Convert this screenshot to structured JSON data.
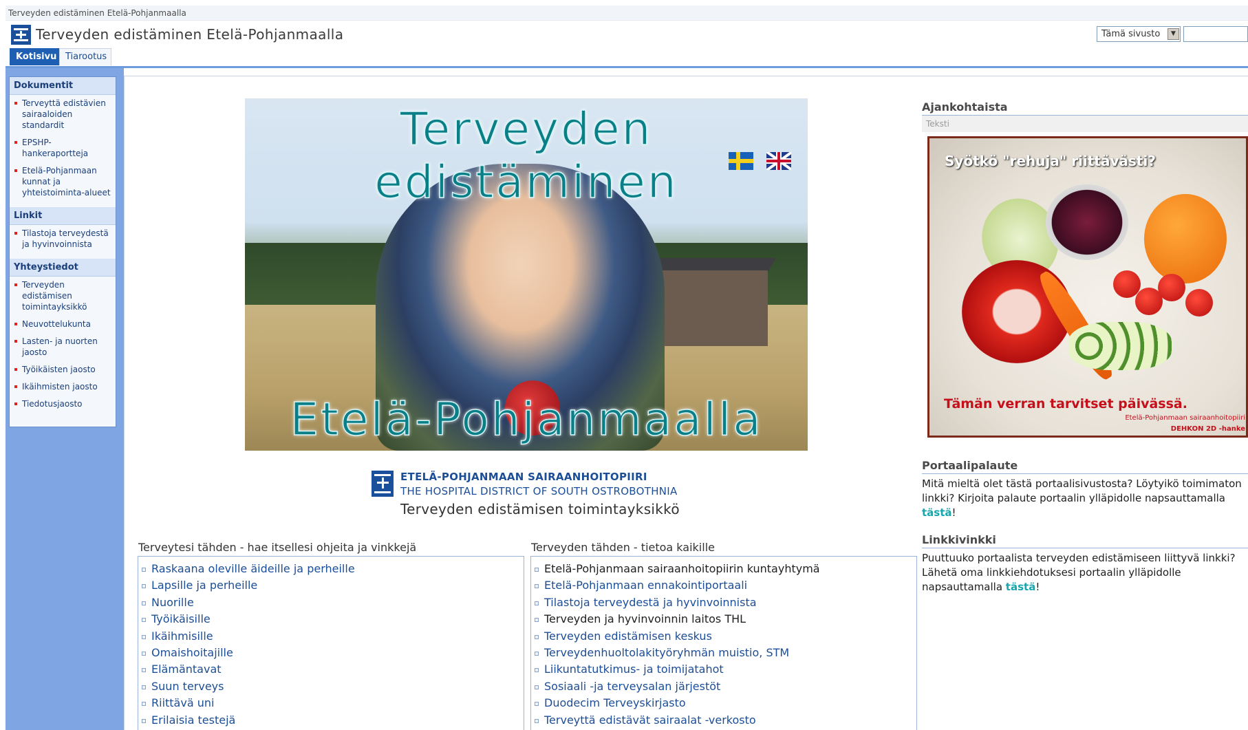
{
  "breadcrumb": "Terveyden edistäminen Etelä-Pohjanmaalla",
  "site": {
    "title": "Terveyden edistäminen Etelä-Pohjanmaalla"
  },
  "search": {
    "scope": "Tämä sivusto",
    "placeholder": ""
  },
  "tabs": [
    {
      "label": "Kotisivu",
      "active": true
    },
    {
      "label": "Tiarootus",
      "active": false
    }
  ],
  "quicklaunch": {
    "sections": [
      {
        "heading": "Dokumentit",
        "items": [
          "Terveyttä edistävien sairaaloiden standardit",
          "EPSHP-hankeraportteja",
          "Etelä-Pohjanmaan kunnat ja yhteistoiminta-alueet"
        ]
      },
      {
        "heading": "Linkit",
        "items": [
          "Tilastoja terveydestä ja hyvinvoinnista"
        ]
      },
      {
        "heading": "Yhteystiedot",
        "items": [
          "Terveyden edistämisen toimintayksikkö",
          "Neuvottelukunta",
          "Lasten- ja nuorten jaosto",
          "Työikäisten jaosto",
          "Ikäihmisten jaosto",
          "Tiedotusjaosto"
        ]
      }
    ]
  },
  "hero": {
    "top_text": "Terveyden edistäminen",
    "bottom_text": "Etelä-Pohjanmaalla",
    "flag_se": "flag-sweden",
    "flag_gb": "flag-united-kingdom"
  },
  "org": {
    "name_fi": "ETELÄ-POHJANMAAN SAIRAANHOITOPIIRI",
    "name_en": "THE HOSPITAL DISTRICT OF SOUTH OSTROBOTHNIA",
    "unit": "Terveyden edistämisen toimintayksikkö"
  },
  "left_links": {
    "title": "Terveytesi tähden - hae itsellesi ohjeita ja vinkkejä",
    "items": [
      "Raskaana oleville äideille ja perheille",
      "Lapsille ja perheille",
      "Nuorille",
      "Työikäisille",
      "Ikäihmisille",
      "Omaishoitajille",
      "Elämäntavat",
      "Suun terveys",
      "Riittävä uni",
      "Erilaisia testejä"
    ]
  },
  "right_links": {
    "title": "Terveyden tähden - tietoa kaikille",
    "items": [
      "Etelä-Pohjanmaan sairaanhoitopiirin kuntayhtymä",
      "Etelä-Pohjanmaan ennakointiportaali",
      "Tilastoja terveydestä ja hyvinvoinnista",
      "Terveyden ja hyvinvoinnin laitos THL",
      "Terveyden edistämisen keskus",
      "Terveydenhuoltolakityöryhmän muistio, STM",
      "Liikuntatutkimus- ja toimijatahot",
      "Sosiaali -ja terveysalan järjestöt",
      "Duodecim Terveyskirjasto",
      "Terveyttä edistävät sairaalat -verkosto"
    ]
  },
  "news": {
    "title": "Ajankohtaista",
    "sub": "Teksti",
    "ad_title": "Syötkö \"rehuja\" riittävästi?",
    "ad_footer": "Tämän verran tarvitset päivässä.",
    "ad_credit1": "Etelä-Pohjanmaan sairaanhoitopiiri",
    "ad_credit2": "DEHKON 2D -hanke"
  },
  "feedback": {
    "title": "Portaalipalaute",
    "text": "Mitä mieltä olet tästä portaalisivustosta? Löytyikö toimimaton linkki? Kirjoita palaute portaalin ylläpidolle napsauttamalla ",
    "link": "tästä",
    "end": "!"
  },
  "tip": {
    "title": "Linkkivinkki",
    "text": "Puuttuuko portaalista terveyden edistämiseen liittyvä linkki? Lähetä oma linkkiehdotuksesi portaalin ylläpidolle napsauttamalla ",
    "link": "tästä",
    "end": "!"
  }
}
